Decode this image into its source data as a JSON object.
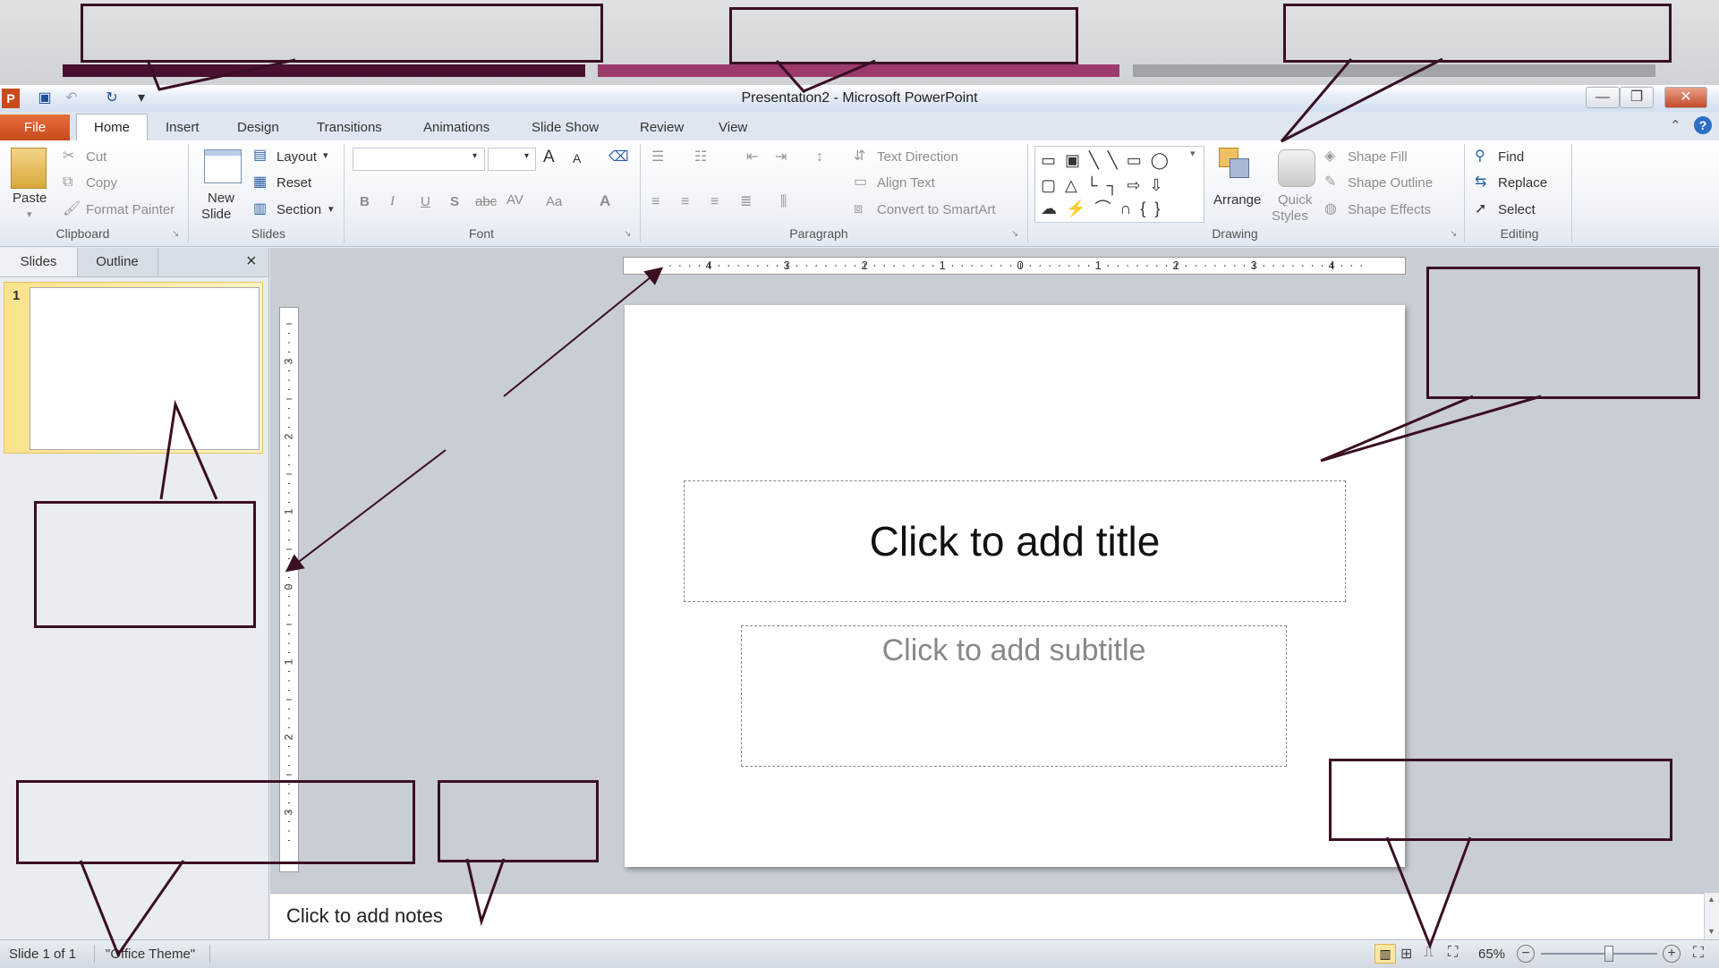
{
  "window": {
    "title": "Presentation2 - Microsoft PowerPoint",
    "qat_icons": [
      "save-icon",
      "undo-icon",
      "redo-icon",
      "customize-qat-icon"
    ],
    "controls": [
      "minimize-icon",
      "restore-icon",
      "close-icon"
    ]
  },
  "colors": {
    "band_1": "#4a1030",
    "band_2": "#9c3a6c",
    "band_3": "#a0a3a8",
    "callout_border": "#3a0f24",
    "file_tab": "#d55a2a"
  },
  "tabs": {
    "file": "File",
    "items": [
      "Home",
      "Insert",
      "Design",
      "Transitions",
      "Animations",
      "Slide Show",
      "Review",
      "View"
    ]
  },
  "ribbon": {
    "clipboard": {
      "label": "Clipboard",
      "paste": "Paste",
      "cut": "Cut",
      "copy": "Copy",
      "format_painter": "Format Painter"
    },
    "slides": {
      "label": "Slides",
      "new_slide_line1": "New",
      "new_slide_line2": "Slide",
      "layout": "Layout",
      "reset": "Reset",
      "section": "Section"
    },
    "font": {
      "label": "Font",
      "bold": "B",
      "italic": "I",
      "underline": "U",
      "shadow": "S",
      "strike": "abc",
      "spacing": "AV",
      "case": "Aa",
      "color": "A",
      "grow": "A",
      "shrink": "A"
    },
    "paragraph": {
      "label": "Paragraph",
      "text_direction": "Text Direction",
      "align_text": "Align Text",
      "smartart": "Convert to SmartArt"
    },
    "drawing": {
      "label": "Drawing",
      "arrange": "Arrange",
      "quick_styles_line1": "Quick",
      "quick_styles_line2": "Styles",
      "shape_fill": "Shape Fill",
      "shape_outline": "Shape Outline",
      "shape_effects": "Shape Effects"
    },
    "editing": {
      "label": "Editing",
      "find": "Find",
      "replace": "Replace",
      "select": "Select"
    }
  },
  "pane": {
    "tab_slides": "Slides",
    "tab_outline": "Outline",
    "close": "×",
    "thumb_number": "1"
  },
  "ruler": {
    "h_labels": [
      "4",
      "3",
      "2",
      "1",
      "0",
      "1",
      "2",
      "3",
      "4"
    ],
    "v_labels": [
      "3",
      "2",
      "1",
      "0",
      "1",
      "2",
      "3"
    ]
  },
  "slide": {
    "title_placeholder": "Click to add title",
    "subtitle_placeholder": "Click to add subtitle"
  },
  "notes": {
    "placeholder": "Click to add notes"
  },
  "status": {
    "slide_info": "Slide 1 of 1",
    "theme": "\"Office Theme\"",
    "zoom": "65%",
    "zoom_fraction": 0.58
  }
}
